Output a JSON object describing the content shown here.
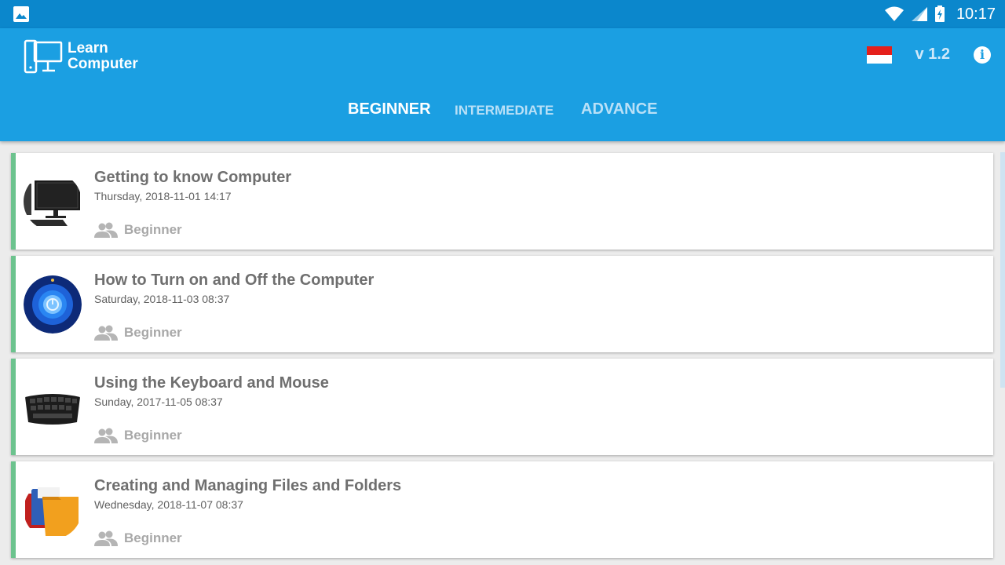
{
  "status_bar": {
    "time": "10:17"
  },
  "header": {
    "logo_line1": "Learn",
    "logo_line2": "Computer",
    "version": "v 1.2",
    "info_glyph": "i"
  },
  "tabs": [
    {
      "label": "BEGINNER",
      "active": true
    },
    {
      "label": "INTERMEDIATE",
      "active": false
    },
    {
      "label": "ADVANCE",
      "active": false
    }
  ],
  "lessons": [
    {
      "title": "Getting to know Computer",
      "date": "Thursday, 2018-11-01 14:17",
      "level": "Beginner",
      "thumb": "computer-monitor"
    },
    {
      "title": "How to Turn on and Off the Computer",
      "date": "Saturday, 2018-11-03 08:37",
      "level": "Beginner",
      "thumb": "power-button"
    },
    {
      "title": "Using the Keyboard and Mouse",
      "date": "Sunday, 2017-11-05 08:37",
      "level": "Beginner",
      "thumb": "keyboard"
    },
    {
      "title": "Creating and Managing Files and Folders",
      "date": "Wednesday, 2018-11-07 08:37",
      "level": "Beginner",
      "thumb": "folders"
    }
  ],
  "colors": {
    "status_bar": "#0b87cc",
    "header": "#1b9fe2",
    "card_accent": "#6cc38e"
  }
}
